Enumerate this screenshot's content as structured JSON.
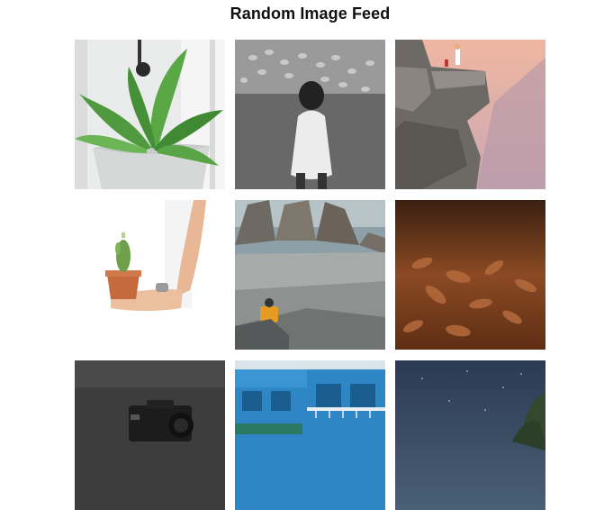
{
  "page": {
    "title": "Random Image Feed"
  },
  "feed": {
    "images": [
      {
        "subject": "potted-fern"
      },
      {
        "subject": "girl-with-sheep"
      },
      {
        "subject": "cliff-edge-figures"
      },
      {
        "subject": "hand-holding-cactus"
      },
      {
        "subject": "mountain-hiker"
      },
      {
        "subject": "dry-leaves"
      },
      {
        "subject": "camera"
      },
      {
        "subject": "blue-building"
      },
      {
        "subject": "night-sky-tree"
      }
    ]
  },
  "colors": {
    "background": "#ffffff",
    "title": "#111111"
  }
}
